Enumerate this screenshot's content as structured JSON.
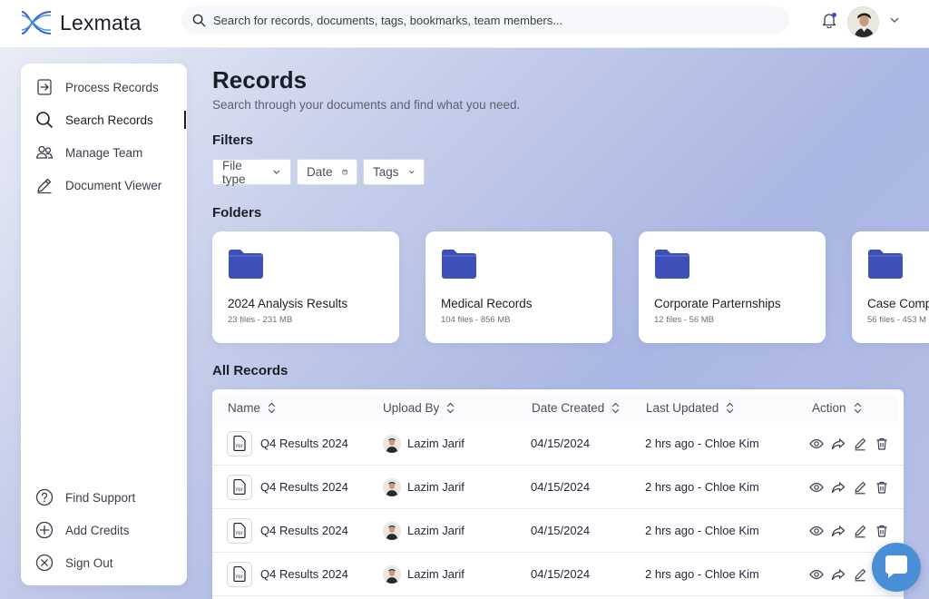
{
  "app": {
    "name": "Lexmata"
  },
  "search": {
    "placeholder": "Search for records, documents, tags, bookmarks, team members..."
  },
  "sidebar": {
    "items": [
      {
        "label": "Process Records",
        "icon": "process-records-icon"
      },
      {
        "label": "Search Records",
        "icon": "search-icon",
        "active": true
      },
      {
        "label": "Manage Team",
        "icon": "team-icon"
      },
      {
        "label": "Document Viewer",
        "icon": "pen-icon"
      }
    ],
    "bottom_items": [
      {
        "label": "Find Support",
        "icon": "help-icon"
      },
      {
        "label": "Add Credits",
        "icon": "plus-circle-icon"
      },
      {
        "label": "Sign Out",
        "icon": "close-circle-icon"
      }
    ]
  },
  "page": {
    "title": "Records",
    "subtitle": "Search through your documents and find what you need."
  },
  "filters": {
    "title": "Filters",
    "items": [
      {
        "label": "File type",
        "icon": "chevron-down-icon"
      },
      {
        "label": "Date",
        "icon": "calendar-icon"
      },
      {
        "label": "Tags",
        "icon": "chevron-down-icon"
      }
    ]
  },
  "folders": {
    "title": "Folders",
    "items": [
      {
        "name": "2024 Analysis Results",
        "meta": "23 files - 231 MB"
      },
      {
        "name": "Medical Records",
        "meta": "104 files - 856 MB"
      },
      {
        "name": "Corporate Parternships",
        "meta": "12 files - 56 MB"
      },
      {
        "name": "Case Comp",
        "meta": "56 files - 453 M"
      }
    ]
  },
  "records": {
    "title": "All Records",
    "columns": [
      "Name",
      "Upload By",
      "Date Created",
      "Last Updated",
      "Action"
    ],
    "rows": [
      {
        "name": "Q4 Results 2024",
        "uploader": "Lazim Jarif",
        "created": "04/15/2024",
        "updated": "2 hrs ago - Chloe Kim"
      },
      {
        "name": "Q4 Results 2024",
        "uploader": "Lazim Jarif",
        "created": "04/15/2024",
        "updated": "2 hrs ago - Chloe Kim"
      },
      {
        "name": "Q4 Results 2024",
        "uploader": "Lazim Jarif",
        "created": "04/15/2024",
        "updated": "2 hrs ago - Chloe Kim"
      },
      {
        "name": "Q4 Results 2024",
        "uploader": "Lazim Jarif",
        "created": "04/15/2024",
        "updated": "2 hrs ago - Chloe Kim"
      }
    ],
    "actions": [
      "view-icon",
      "share-icon",
      "edit-icon",
      "delete-icon"
    ]
  },
  "colors": {
    "accent": "#3b4ecf",
    "folder": "#3d4fb8",
    "chat": "#4a8ed6"
  }
}
